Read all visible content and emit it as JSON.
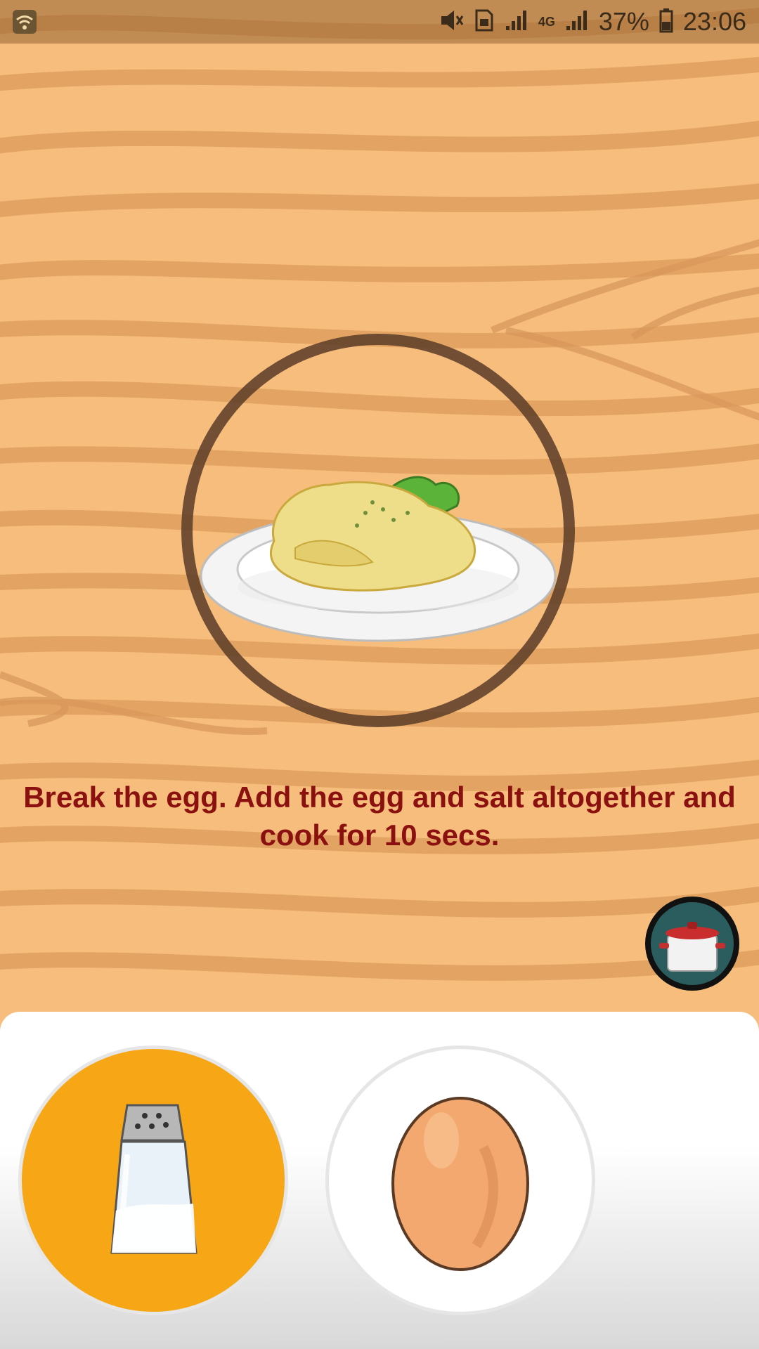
{
  "status_bar": {
    "battery_percent": "37%",
    "time": "23:06",
    "network_type": "4G",
    "icons": [
      "wifi-icon",
      "mute-icon",
      "sim-icon",
      "signal-icon",
      "signal-icon",
      "battery-icon"
    ]
  },
  "game": {
    "instruction": "Break the egg. Add the egg and salt altogether and cook for 10 secs.",
    "target_dish": "omelette-plate",
    "cook_button_icon": "pot-icon"
  },
  "tray": {
    "items": [
      {
        "name": "salt",
        "icon": "salt-shaker-icon",
        "selected": true
      },
      {
        "name": "egg",
        "icon": "egg-icon",
        "selected": false
      }
    ]
  },
  "colors": {
    "wood": "#f6bd7c",
    "wood_grain": "#e4a463",
    "instruction_text": "#8b1010",
    "selected_slot": "#f7a615",
    "cook_button": "#2b5d5e"
  }
}
